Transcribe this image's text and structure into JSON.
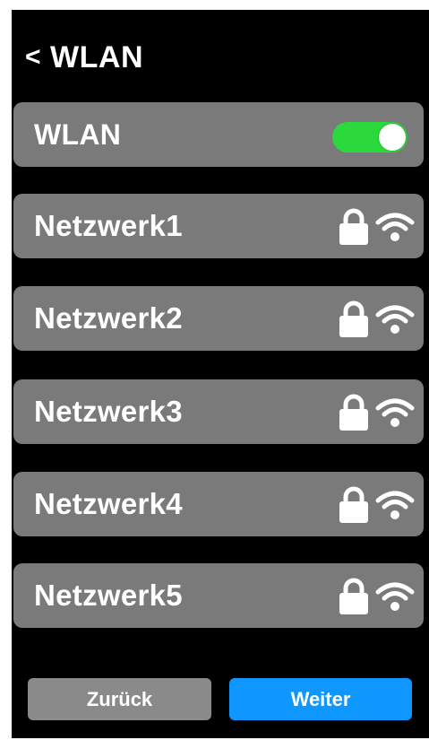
{
  "header": {
    "back_chevron": "<",
    "title": "WLAN"
  },
  "wlan_toggle": {
    "label": "WLAN",
    "enabled": true,
    "color": "#2bd93d"
  },
  "networks": [
    {
      "name": "Netzwerk1",
      "locked": true,
      "icon": "wifi-icon"
    },
    {
      "name": "Netzwerk2",
      "locked": true,
      "icon": "wifi-icon"
    },
    {
      "name": "Netzwerk3",
      "locked": true,
      "icon": "wifi-icon"
    },
    {
      "name": "Netzwerk4",
      "locked": true,
      "icon": "wifi-icon"
    },
    {
      "name": "Netzwerk5",
      "locked": true,
      "icon": "wifi-icon"
    }
  ],
  "footer": {
    "back_label": "Zurück",
    "next_label": "Weiter"
  },
  "colors": {
    "background": "#000000",
    "row": "#7a7a7a",
    "accent": "#0d97ff",
    "secondary_button": "#8a8a8a"
  }
}
